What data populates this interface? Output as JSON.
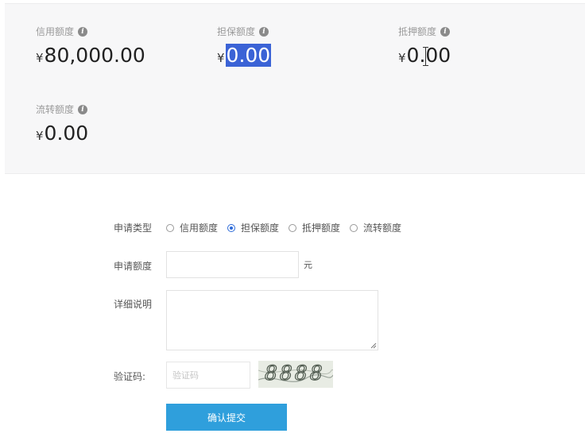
{
  "summary": {
    "cards": [
      {
        "label": "信用额度",
        "currency": "¥",
        "amount": "80,000.00"
      },
      {
        "label": "担保额度",
        "currency": "¥",
        "amount": "0.00"
      },
      {
        "label": "抵押额度",
        "currency": "¥",
        "amount": "0.00"
      },
      {
        "label": "流转额度",
        "currency": "¥",
        "amount": "0.00"
      }
    ],
    "info_icon_glyph": "i"
  },
  "form": {
    "type_label": "申请类型",
    "options": [
      "信用额度",
      "担保额度",
      "抵押额度",
      "流转额度"
    ],
    "selected_option": "担保额度",
    "amount_label": "申请额度",
    "amount_value": "",
    "unit": "元",
    "desc_label": "详细说明",
    "desc_value": "",
    "captcha_label": "验证码:",
    "captcha_placeholder": "验证码",
    "captcha_text": "8888",
    "submit_label": "确认提交",
    "accent_color": "#2f9fdc",
    "radio_color": "#2e6bd8"
  }
}
